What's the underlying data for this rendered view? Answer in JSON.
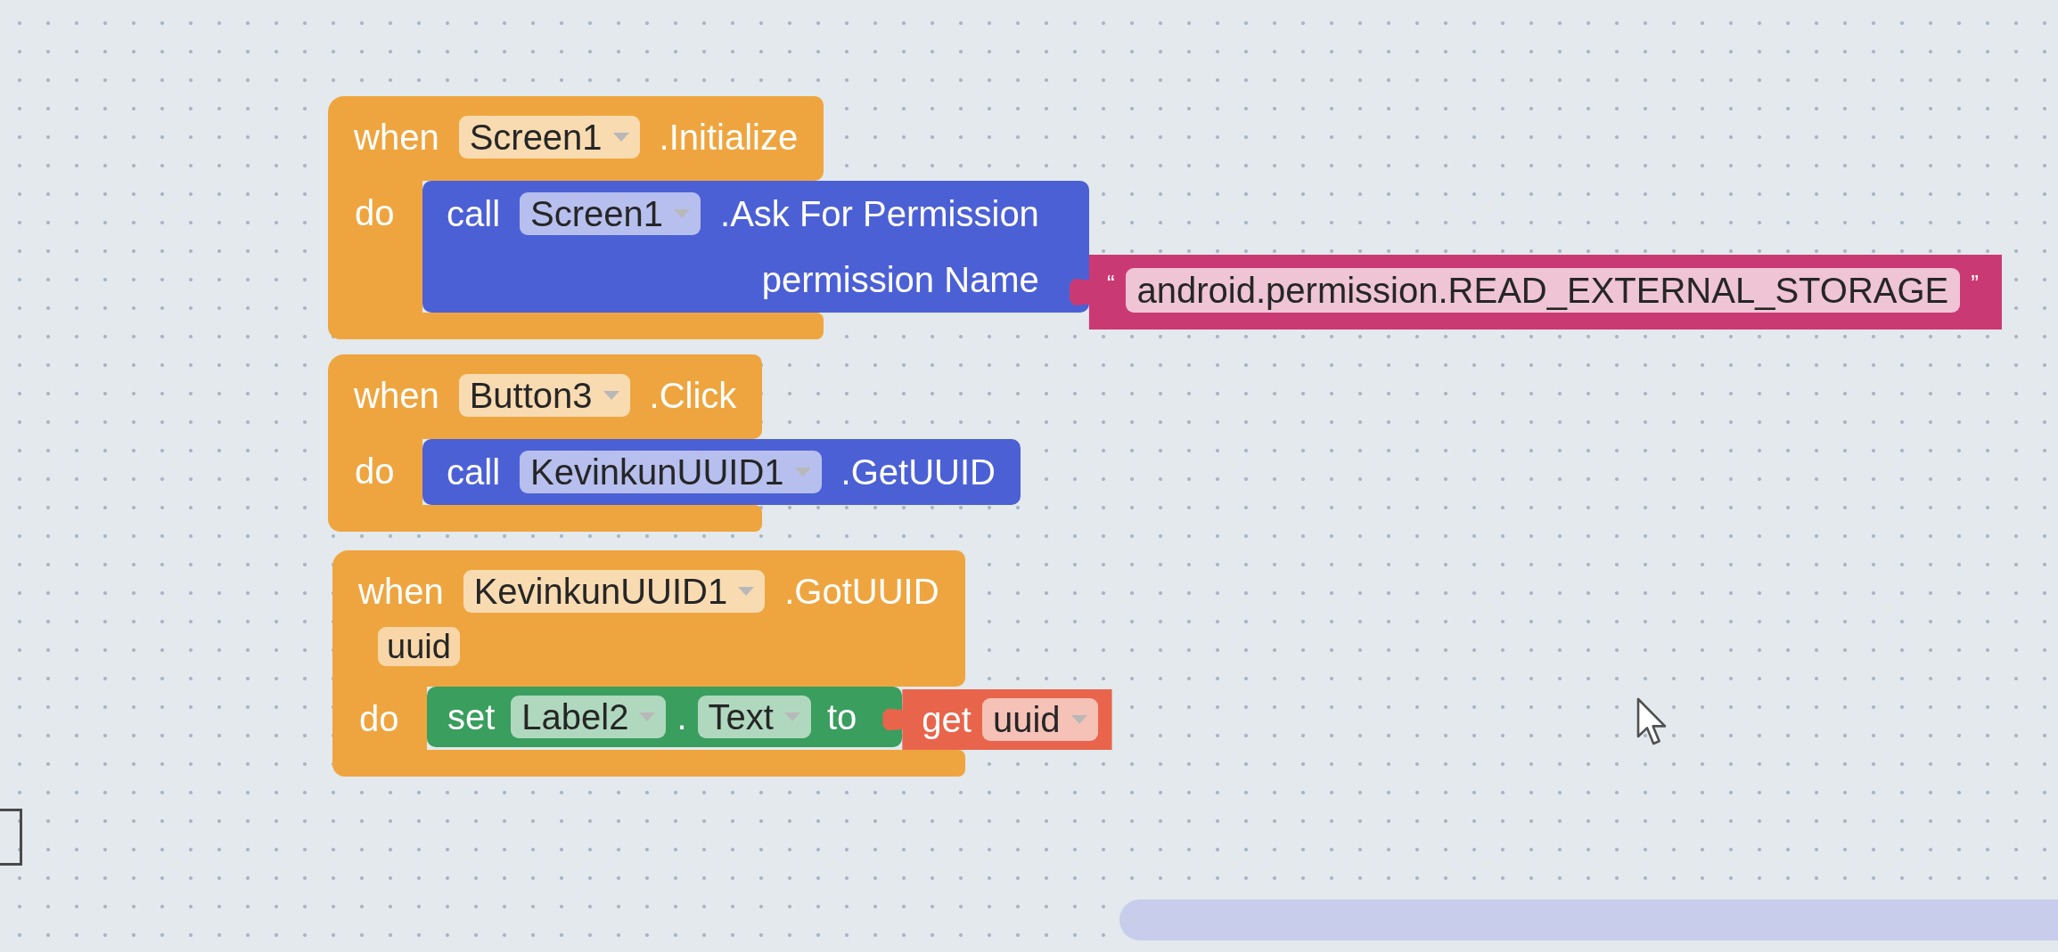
{
  "workspace": {
    "blocks": [
      {
        "keyword": "when",
        "component": "Screen1",
        "event": ".Initialize",
        "do_label": "do",
        "statements": [
          {
            "kind": "call",
            "keyword": "call",
            "component": "Screen1",
            "method": ".Ask For Permission",
            "arguments": [
              {
                "name": "permission Name",
                "value": {
                  "kind": "text",
                  "open_quote": "“",
                  "text": "android.permission.READ_EXTERNAL_STORAGE",
                  "close_quote": "”"
                }
              }
            ]
          }
        ]
      },
      {
        "keyword": "when",
        "component": "Button3",
        "event": ".Click",
        "do_label": "do",
        "statements": [
          {
            "kind": "call",
            "keyword": "call",
            "component": "KevinkunUUID1",
            "method": ".GetUUID"
          }
        ]
      },
      {
        "keyword": "when",
        "component": "KevinkunUUID1",
        "event": ".GotUUID",
        "parameters": [
          "uuid"
        ],
        "do_label": "do",
        "statements": [
          {
            "kind": "set",
            "keyword": "set",
            "component": "Label2",
            "separator": ".",
            "property": "Text",
            "to_label": "to",
            "value": {
              "kind": "get",
              "keyword": "get",
              "variable": "uuid"
            }
          }
        ]
      }
    ]
  }
}
